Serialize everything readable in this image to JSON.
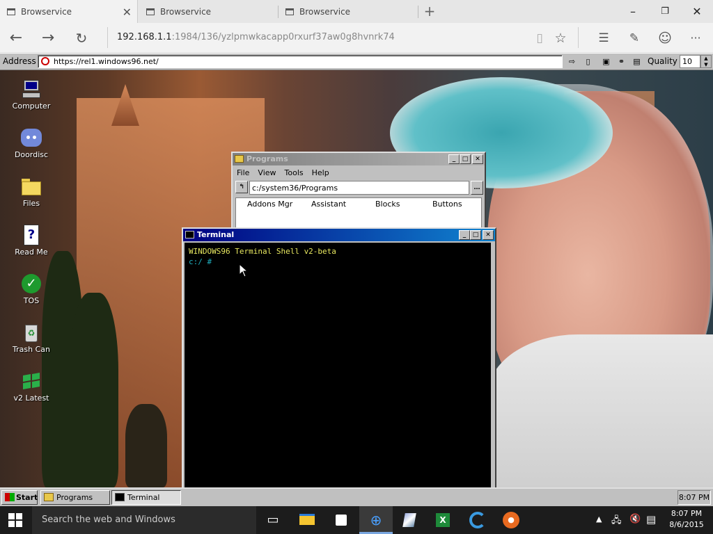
{
  "browser": {
    "tabs": [
      {
        "label": "Browservice",
        "active": true
      },
      {
        "label": "Browservice",
        "active": false
      },
      {
        "label": "Browservice",
        "active": false
      }
    ],
    "url_host": "192.168.1.1",
    "url_rest": ":1984/136/yzlpmwkacapp0rxurf37aw0g8hvnrk74"
  },
  "win96_address": {
    "label": "Address",
    "url": "https://rel1.windows96.net/",
    "quality_label": "Quality",
    "quality_value": "10"
  },
  "desktop_icons": [
    {
      "label": "Computer",
      "icon": "computer-icon"
    },
    {
      "label": "Doordisc",
      "icon": "discord-icon"
    },
    {
      "label": "Files",
      "icon": "folder-icon"
    },
    {
      "label": "Read Me",
      "icon": "readme-icon"
    },
    {
      "label": "TOS",
      "icon": "checkmark-icon"
    },
    {
      "label": "Trash Can",
      "icon": "trash-icon"
    },
    {
      "label": "v2 Latest",
      "icon": "windows-logo-icon"
    }
  ],
  "programs_window": {
    "title": "Programs",
    "menu": [
      "File",
      "View",
      "Tools",
      "Help"
    ],
    "path": "c:/system36/Programs",
    "items": [
      "Addons Mgr",
      "Assistant",
      "Blocks",
      "Buttons"
    ]
  },
  "terminal_window": {
    "title": "Terminal",
    "line1": "WINDOWS96 Terminal Shell v2-beta",
    "prompt": "c:/ #"
  },
  "taskbar96": {
    "start_label": "Start",
    "tasks": [
      {
        "label": "Programs",
        "pressed": false
      },
      {
        "label": "Terminal",
        "pressed": true
      }
    ],
    "clock": "8:07 PM"
  },
  "taskbar10": {
    "search_placeholder": "Search the web and Windows",
    "time": "8:07 PM",
    "date": "8/6/2015"
  }
}
